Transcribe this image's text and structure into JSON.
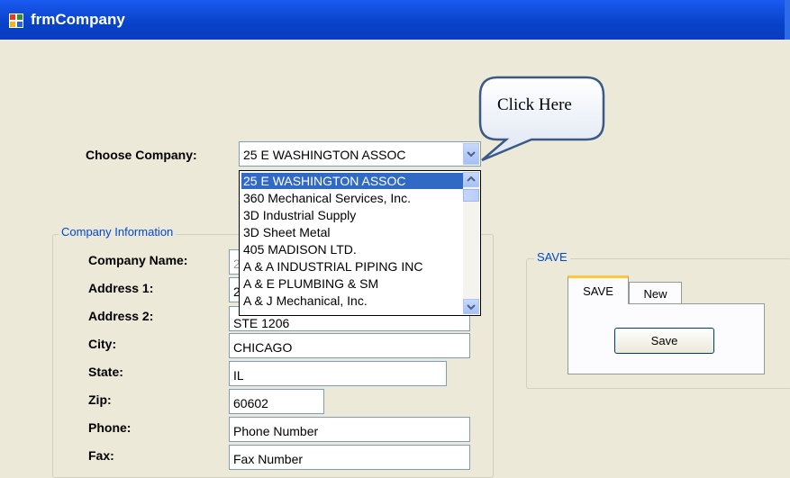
{
  "window": {
    "title": "frmCompany"
  },
  "choose_company": {
    "label": "Choose Company:",
    "selected": "25 E WASHINGTON ASSOC",
    "options": [
      "25 E WASHINGTON ASSOC",
      "360 Mechanical Services, Inc.",
      "3D Industrial Supply",
      "3D Sheet Metal",
      "405 MADISON LTD.",
      "A & A INDUSTRIAL PIPING INC",
      "A & E PLUMBING & SM",
      "A & J Mechanical, Inc."
    ]
  },
  "callout": {
    "text": "Click Here"
  },
  "company_info": {
    "group_label": "Company Information",
    "fields": {
      "company_name": {
        "label": "Company Name:",
        "value": "2"
      },
      "address1": {
        "label": "Address 1:",
        "value": "2"
      },
      "address2": {
        "label": "Address 2:",
        "value": "STE 1206"
      },
      "city": {
        "label": "City:",
        "value": "CHICAGO"
      },
      "state": {
        "label": "State:",
        "value": "IL"
      },
      "zip": {
        "label": "Zip:",
        "value": "60602"
      },
      "phone": {
        "label": "Phone:",
        "value": "Phone Number"
      },
      "fax": {
        "label": "Fax:",
        "value": "Fax Number"
      }
    }
  },
  "save_group": {
    "group_label": "SAVE",
    "tabs": [
      "SAVE",
      "New"
    ],
    "active_tab": "SAVE",
    "save_button": "Save"
  },
  "colors": {
    "titlebar": "#0842c9",
    "selection": "#316ac5",
    "group_label": "#0046d5",
    "tab_highlight": "#ffc83c"
  }
}
